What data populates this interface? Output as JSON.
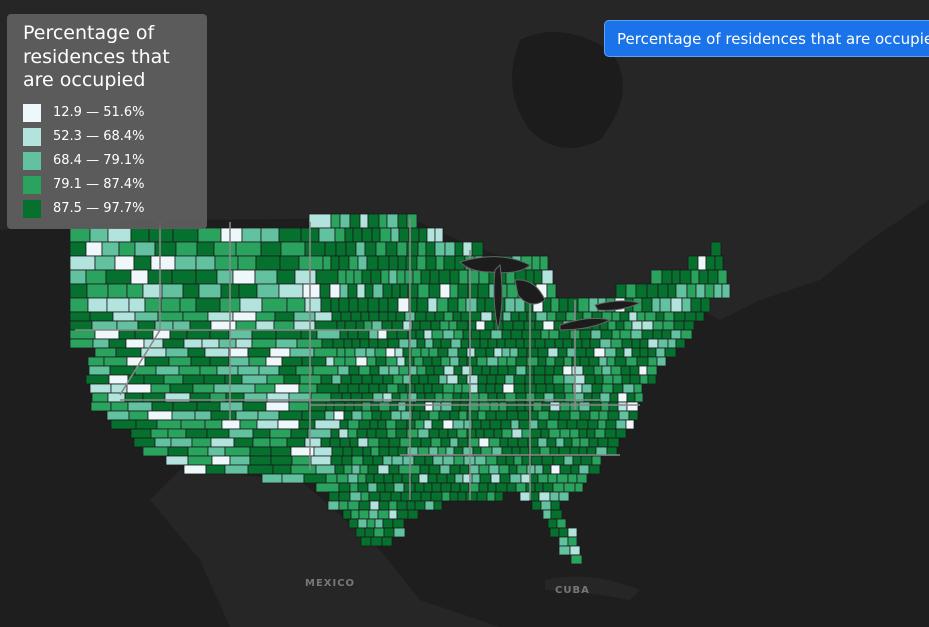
{
  "legend": {
    "title_lines": [
      "Percentage of",
      "residences that",
      "are occupied"
    ],
    "items": [
      {
        "label": "12.9 — 51.6%",
        "color": "#eef8fb"
      },
      {
        "label": "52.3 — 68.4%",
        "color": "#b3e3dd"
      },
      {
        "label": "68.4 — 79.1%",
        "color": "#62c2a0"
      },
      {
        "label": "79.1 — 87.4%",
        "color": "#2aa35f"
      },
      {
        "label": "87.5 — 97.7%",
        "color": "#06702e"
      }
    ]
  },
  "title_button": {
    "label": "Percentage of residences that are occupied"
  },
  "map": {
    "place_labels": {
      "mexico": "MEXICO",
      "cuba": "CUBA"
    },
    "background_color": "#1e1e1e",
    "land_color": "#262626",
    "border_color": "#888888"
  }
}
